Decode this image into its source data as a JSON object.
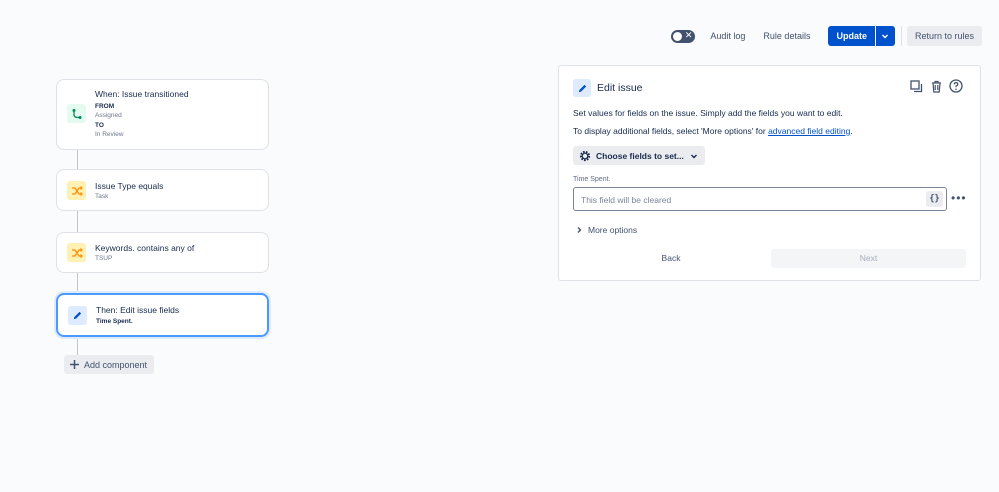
{
  "topbar": {
    "audit_log": "Audit log",
    "rule_details": "Rule details",
    "update": "Update",
    "return_to_rules": "Return to rules"
  },
  "flow": {
    "trigger": {
      "title": "When: Issue transitioned",
      "from_label": "FROM",
      "from_value": "Assigned",
      "to_label": "TO",
      "to_value": "In Review"
    },
    "condition1": {
      "title": "Issue Type equals",
      "value": "Task"
    },
    "condition2": {
      "title": "Keywords. contains any of",
      "value": "TSUP"
    },
    "action": {
      "title": "Then: Edit issue fields",
      "value": "Time Spent."
    },
    "add_component": "Add component"
  },
  "panel": {
    "title": "Edit issue",
    "desc1": "Set values for fields on the issue. Simply add the fields you want to edit.",
    "desc2_prefix": "To display additional fields, select 'More options' for ",
    "desc2_link": "advanced field editing",
    "desc2_suffix": ".",
    "choose_fields": "Choose fields to set...",
    "field_label": "Time Spent.",
    "field_placeholder": "This field will be cleared",
    "field_brace": "{}",
    "more_options": "More options",
    "back": "Back",
    "next": "Next"
  },
  "colors": {
    "primary": "#0052cc",
    "selected_border": "#4c9aff",
    "trigger_icon_bg": "#e3fcef",
    "condition_icon_bg": "#fff0b3"
  }
}
